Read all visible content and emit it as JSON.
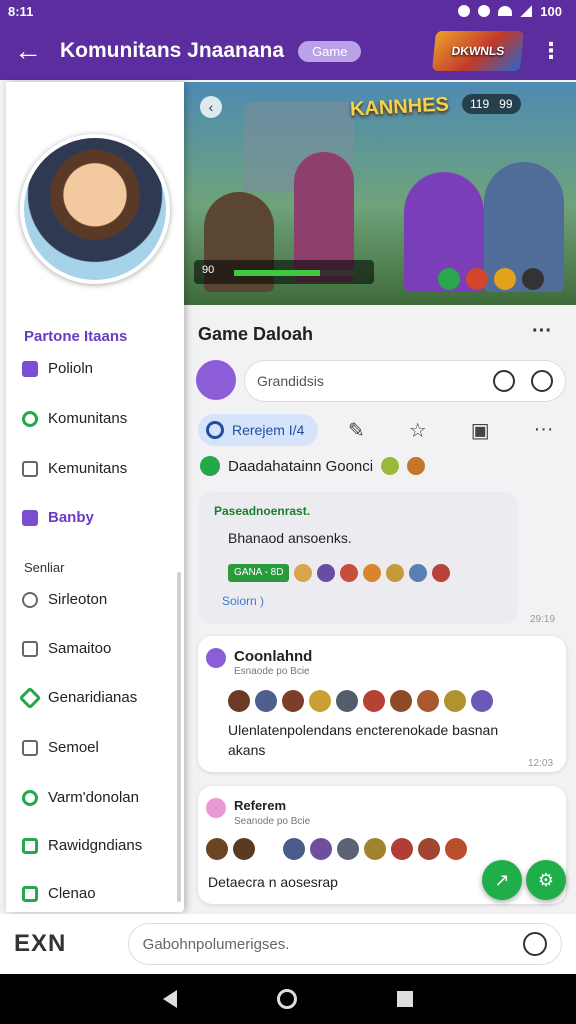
{
  "status_bar": {
    "time": "8:11",
    "right_text": "100"
  },
  "header": {
    "back_icon": "←",
    "title": "Komunitans Jnaanana",
    "pill": "Game",
    "logo_text": "DKWNLS"
  },
  "drawer": {
    "section_title": "Partone Itaans",
    "items": [
      {
        "label": "Polioln",
        "icon": "purple"
      },
      {
        "label": "Komunitans",
        "icon": "green"
      },
      {
        "label": "Kemunitans",
        "icon": "gray"
      },
      {
        "label": "Banby",
        "icon": "purple",
        "active": true
      }
    ],
    "section2_title": "Senliar",
    "items2": [
      {
        "label": "Sirleoton",
        "icon": "gray"
      },
      {
        "label": "Samaitoo",
        "icon": "gray"
      },
      {
        "label": "Genaridianas",
        "icon": "greensq"
      },
      {
        "label": "Semoel",
        "icon": "gray"
      },
      {
        "label": "Varm'donolan",
        "icon": "green"
      },
      {
        "label": "Rawidgndians",
        "icon": "greensq"
      },
      {
        "label": "Clenao",
        "icon": "greensq"
      }
    ]
  },
  "banner": {
    "logo": "KANNHES",
    "hud_left": "119",
    "hud_right": "99",
    "hp_label": "90",
    "hp_fill": 0.72
  },
  "feed": {
    "title": "Game Daloah",
    "composer_placeholder": "Grandidsis",
    "chip_label": "Rerejem I/4",
    "section_label": "Daadahatainn Goonci",
    "post1": {
      "title": "Paseadnoenrast.",
      "body": "Bhanaod ansoenks.",
      "tag": "GANA - 8D",
      "link": "Soiorn )",
      "time": "29:19"
    },
    "post2": {
      "title": "Coonlahnd",
      "sub": "Esnaode po Bcie",
      "body_line1": "Ulenlatenpolendans encterenokade basnan",
      "body_line2": "akans",
      "time": "12:03"
    },
    "post3": {
      "title": "Referem",
      "sub": "Seanode po Bcie",
      "body": "Detaecra n aosesrap"
    }
  },
  "bottom": {
    "logo": "EXN",
    "placeholder": "Gabohnpolumerigses."
  },
  "colors": {
    "accent": "#5b2d9e",
    "green": "#1fae4a",
    "link": "#3a7bd5"
  }
}
